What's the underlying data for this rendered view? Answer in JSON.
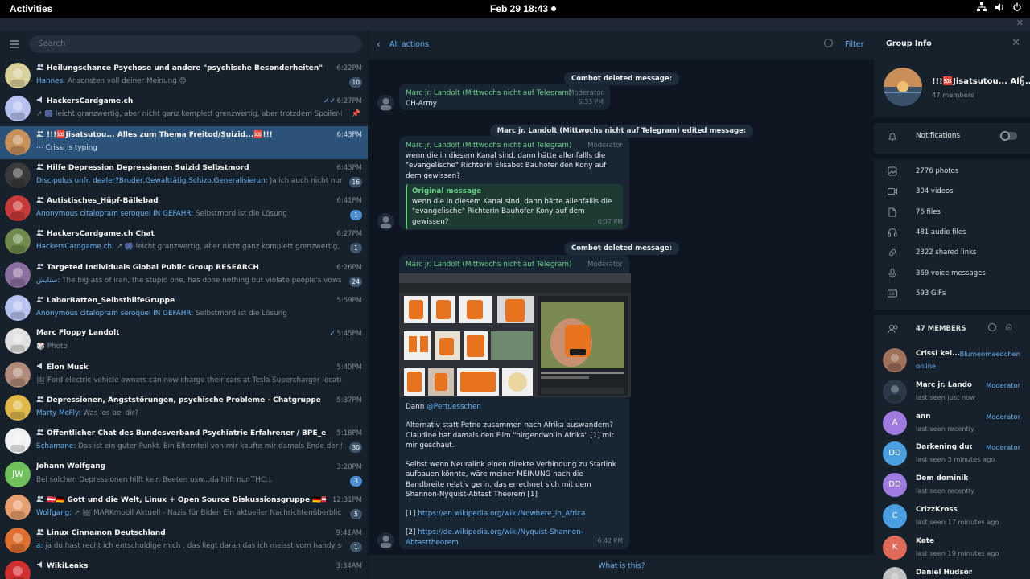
{
  "topbar": {
    "activities": "Activities",
    "clock": "Feb 29  18:43"
  },
  "colors": {
    "accent": "#6ab3f3",
    "active": "#2b5278",
    "sender": "#6bd088"
  },
  "search": {
    "placeholder": "Search"
  },
  "chats": [
    {
      "title": "Heilungschance Psychose und andere \"psychische Besonderheiten\" 🔮🌈🌙",
      "sender": "Hannes:",
      "text": " Ansonsten voll deiner Meinung 😊",
      "time": "6:22PM",
      "badge": "10",
      "avatar": "#d9d19a",
      "icon": "group-icon"
    },
    {
      "title": "HackersCardgame.ch",
      "sender": "",
      "text": "↗ 🎆 leicht granzwertig, aber nicht ganz komplett grenzwertig, aber trotzdem Spoiler-Funktion",
      "time": "6:27PM",
      "tick": "✓✓",
      "pin": "📌",
      "avatar": "#b6c2f0",
      "icon": "channel-icon"
    },
    {
      "title": "!!!🆘Jisatsutou... Alles zum Thema Freitod/Suizid...🆘!!!",
      "sender": "",
      "text": "⋯ Crissi is typing",
      "time": "6:43PM",
      "avatar": "#c8905a",
      "icon": "group-icon",
      "active": true
    },
    {
      "title": "Hilfe Depression Depressionen Suizid Selbstmord",
      "sender": "Discipulus unfr. dealer?Bruder,Gewalttätig,Schizo,Generalisierun:",
      "text": " Ja ich auch nicht nur mein Br...",
      "time": "6:43PM",
      "badge": "16",
      "avatar": "#3a3a3a",
      "icon": "group-icon"
    },
    {
      "title": "Autistisches_Hüpf-Bällebad",
      "sender": "Anonymous citalopram seroquel IN GEFAHR:",
      "text": " Selbstmord ist die Lösung",
      "time": "6:41PM",
      "badge": "1",
      "badgeBlue": true,
      "avatar": "#c73a3a",
      "icon": "group-icon"
    },
    {
      "title": "HackersCardgame.ch Chat",
      "sender": "HackersCardgame.ch:",
      "text": " ↗ 🎆 leicht granzwertig, aber nicht ganz komplett grenzwertig, aber trot...",
      "time": "6:27PM",
      "badge": "1",
      "avatar": "#6f8a4c",
      "icon": "group-icon"
    },
    {
      "title": "Targeted Individuals Global Public Group RESEARCH",
      "sender": "ستايش:",
      "text": " The big ass of iran, the stupid one, has done nothing but violate people's vows",
      "time": "6:26PM",
      "badge": "24",
      "avatar": "#8a6fa0",
      "icon": "group-icon"
    },
    {
      "title": "LaborRatten_SelbsthilfeGruppe",
      "sender": "Anonymous citalopram seroquel IN GEFAHR:",
      "text": " Selbstmord ist die Lösung",
      "time": "5:59PM",
      "avatar": "#b6c2f0",
      "icon": "group-icon"
    },
    {
      "title": "Marc Floppy Landolt",
      "sender": "",
      "text": "🎲 Photo",
      "time": "5:45PM",
      "tick": "✓",
      "avatar": "#e0e0e0",
      "icon": ""
    },
    {
      "title": "Elon Musk",
      "sender": "",
      "text": "🖼 Ford electric vehicle owners can now charge their cars at Tesla Supercharger locations across th...",
      "time": "5:40PM",
      "avatar": "#b08a7a",
      "icon": "channel-icon"
    },
    {
      "title": "Depressionen, Angststörungen, psychische Probleme - Chatgruppe",
      "sender": "Marty McFly:",
      "text": " Was los bei dir?",
      "time": "5:37PM",
      "avatar": "#e0b84a",
      "icon": "group-icon"
    },
    {
      "title": "Öffentlicher Chat des Bundesverband Psychiatrie Erfahrener / BPE_e.V.",
      "sender": "Schamane:",
      "text": " Das ist ein guter Punkt. Ein Elternteil von mir kaufte mir damals Ende der 90er Jahr...",
      "time": "5:18PM",
      "badge": "30",
      "avatar": "#f2f2f2",
      "icon": "group-icon"
    },
    {
      "title": "Johann Wolfgang",
      "sender": "",
      "text": "Bei solchen Depressionen hilft kein Beeten usw...da hilft nur THC...",
      "time": "3:20PM",
      "badge": "3",
      "badgeBlue": true,
      "avatar": "#6fbf5a",
      "initials": "JW",
      "icon": ""
    },
    {
      "title": "🇦🇹🇩🇪 Gott und die Welt, Linux + Open Source Diskussionsgruppe 🇩🇪🇦🇹",
      "sender": "Wolfgang:",
      "text": " ↗ 🖼 MARKmobil Aktuell - Nazis für Biden Ein aktueller Nachrichtenüberblick  Die T...",
      "time": "12:31PM",
      "badge": "5",
      "avatar": "#e8a070",
      "icon": "group-icon"
    },
    {
      "title": "Linux Cinnamon Deutschland",
      "sender": "a:",
      "text": " ja du hast recht ich entschuldige mich , das liegt daran das ich meisst vom handy schreibe u...",
      "time": "9:41AM",
      "badge": "1",
      "avatar": "#e07030",
      "icon": "group-icon"
    },
    {
      "title": "WikiLeaks",
      "sender": "",
      "text": "",
      "time": "3:34AM",
      "avatar": "#d03030",
      "icon": "channel-icon"
    }
  ],
  "mid": {
    "back_label": "All actions",
    "filter_label": "Filter",
    "events": [
      {
        "type": "service",
        "text": "Combot deleted message:"
      },
      {
        "type": "bubble",
        "sender": "Marc jr. Landolt (Mittwochs nicht auf Telegram)",
        "role": "Moderator",
        "text": "CH-Army",
        "time": "6:33 PM"
      },
      {
        "type": "service",
        "text": "Marc jr. Landolt (Mittwochs nicht auf Telegram) edited message:"
      },
      {
        "type": "bubble",
        "sender": "Marc jr. Landolt (Mittwochs nicht auf Telegram)",
        "role": "Moderator",
        "text": "wenn die in diesem Kanal sind, dann hätte allenfallls die \"evangelische\" Richterin Elisabet Bauhofer den Kony auf dem gewissen?",
        "quote_title": "Original message",
        "quote_text": "wenn die in diesem Kanal sind, dann hätte allenfallls die \"evangelische\" Richterin Bauhofer Kony auf dem gewissen?",
        "time": "6:37 PM"
      },
      {
        "type": "service",
        "text": "Combot deleted message:"
      },
      {
        "type": "bubble",
        "sender": "Marc jr. Landolt (Mittwochs nicht auf Telegram)",
        "role": "Moderator",
        "pre": "Dann ",
        "mention": "@Pertuesschen",
        "body": "Alternativ statt Petno zusammen nach Afrika auswandern? Claudine hat damals den Film \"nirgendwo in Afrika\" [1] mit mir geschaut.",
        "body2": "Selbst wenn Neuralink einen direkte Verbindung zu Starlink aufbauen könnte, wäre meiner MEINUNG nach die Bandbreite relativ gerin, das errechnet sich mit dem Shannon-Nyquist-Abtast Theorem [1]",
        "ref1_label": "[1] ",
        "ref1_url": "https://en.wikipedia.org/wiki/Nowhere_in_Africa",
        "ref2_label": "[2] ",
        "ref2_url": "https://de.wikipedia.org/wiki/Nyquist-Shannon-Abtasttheorem",
        "time": "6:42 PM"
      }
    ],
    "what_is_this": "What is this?"
  },
  "info": {
    "title": "Group Info",
    "group_name": "!!!🆘Jisatsutou... All...",
    "members_count": "47 members",
    "notifications": "Notifications",
    "stats": [
      {
        "icon": "photo-icon",
        "label": "2776 photos"
      },
      {
        "icon": "video-icon",
        "label": "304 videos"
      },
      {
        "icon": "file-icon",
        "label": "76 files"
      },
      {
        "icon": "headphones-icon",
        "label": "481 audio files"
      },
      {
        "icon": "link-icon",
        "label": "2322 shared links"
      },
      {
        "icon": "microphone-icon",
        "label": "369 voice messages"
      },
      {
        "icon": "gif-icon",
        "label": "593 GIFs"
      }
    ],
    "members_header": "47 MEMBERS",
    "members": [
      {
        "name": "Crissi kei...",
        "status": "online",
        "role": "Blumenmaedchen",
        "color": "#a0705a",
        "online": true
      },
      {
        "name": "Marc jr. Landolt (...",
        "status": "last seen just now",
        "role": "Moderator",
        "color": "#2a3a48"
      },
      {
        "name": "ann",
        "status": "last seen recently",
        "role": "Moderator",
        "color": "#9f7be0",
        "initials": "A"
      },
      {
        "name": "Darkening duck",
        "status": "last seen 3 minutes ago",
        "role": "Moderator",
        "color": "#4a9fe0",
        "initials": "DD"
      },
      {
        "name": "Dom dominik",
        "status": "last seen recently",
        "role": "",
        "color": "#9f7be0",
        "initials": "DD"
      },
      {
        "name": "CrizzKross",
        "status": "last seen 17 minutes ago",
        "role": "",
        "color": "#4a9fe0",
        "initials": "C"
      },
      {
        "name": "Kate",
        "status": "last seen 19 minutes ago",
        "role": "",
        "color": "#e06a5a",
        "initials": "K"
      },
      {
        "name": "Daniel Hudson",
        "status": "",
        "role": "",
        "color": "#c0c0c0"
      }
    ]
  }
}
